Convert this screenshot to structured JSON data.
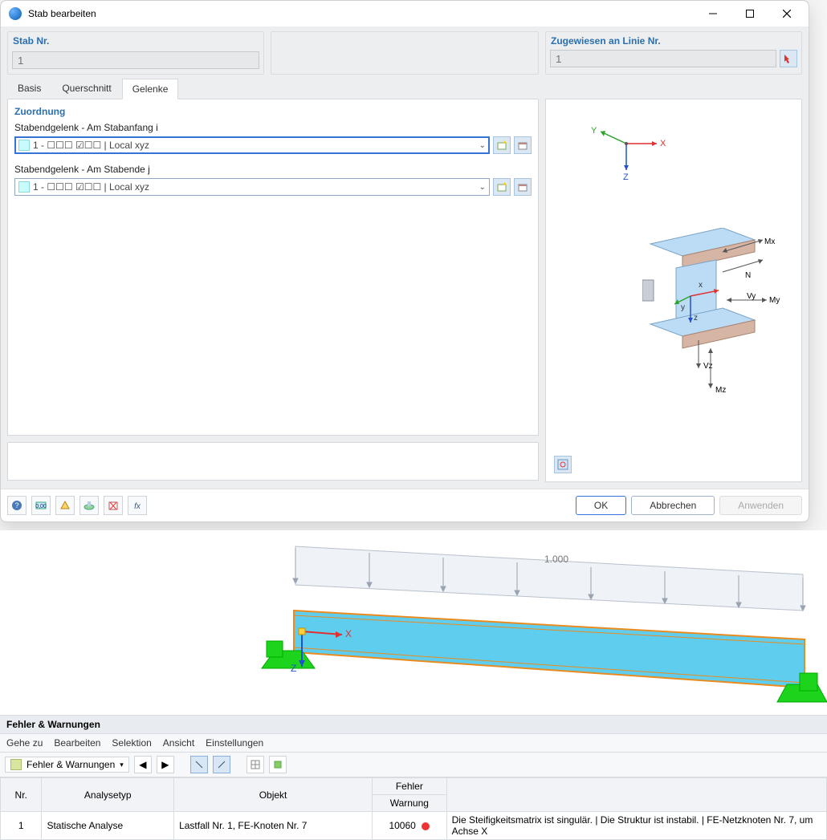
{
  "window": {
    "title": "Stab bearbeiten"
  },
  "stab_nr": {
    "label": "Stab Nr.",
    "value": "1"
  },
  "line_nr": {
    "label": "Zugewiesen an Linie Nr.",
    "value": "1"
  },
  "tabs": {
    "items": [
      "Basis",
      "Querschnitt",
      "Gelenke"
    ],
    "active": 2
  },
  "zuordnung": {
    "heading": "Zuordnung",
    "hinge_i": {
      "label": "Stabendgelenk - Am Stabanfang i",
      "value": "1 - ☐☐☐ ☑☐☐ | Local xyz"
    },
    "hinge_j": {
      "label": "Stabendgelenk - Am Stabende j",
      "value": "1 - ☐☐☐ ☑☐☐ | Local xyz"
    }
  },
  "axes": {
    "x": "X",
    "y": "Y",
    "z": "Z"
  },
  "beam_labels": {
    "n": "N",
    "mx": "Mx",
    "vy": "Vy",
    "my": "My",
    "vz": "Vz",
    "mz": "Mz",
    "x": "x",
    "y": "y",
    "z": "z"
  },
  "buttons": {
    "ok": "OK",
    "cancel": "Abbrechen",
    "apply": "Anwenden"
  },
  "viewport": {
    "load_value": "1.000",
    "axis_x": "X",
    "axis_z": "Z"
  },
  "errors": {
    "title": "Fehler & Warnungen",
    "menu": [
      "Gehe zu",
      "Bearbeiten",
      "Selektion",
      "Ansicht",
      "Einstellungen"
    ],
    "combo": "Fehler & Warnungen",
    "cols": {
      "nr": "Nr.",
      "type": "Analysetyp",
      "obj": "Objekt",
      "fw1": "Fehler",
      "fw2": "Warnung"
    },
    "row": {
      "nr": "1",
      "type": "Statische Analyse",
      "obj": "Lastfall Nr. 1, FE-Knoten Nr. 7",
      "code": "10060",
      "msg": "Die Steifigkeitsmatrix ist singulär. |  Die Struktur ist instabil. | FE-Netzknoten Nr. 7, um Achse X"
    }
  }
}
